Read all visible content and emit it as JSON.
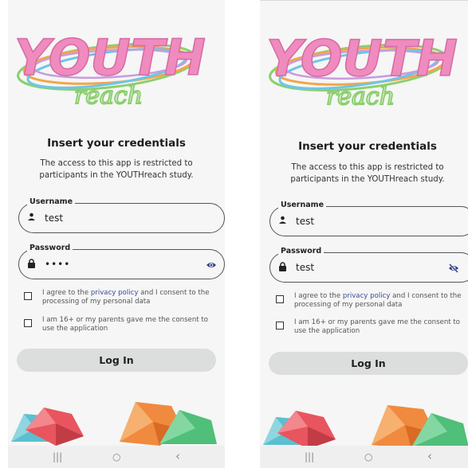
{
  "screens": [
    {
      "heading": "Insert your credentials",
      "description_line1": "The access to this app is restricted to",
      "description_line2": "participants in the YOUTHreach study.",
      "username": {
        "label": "Username",
        "value": "test"
      },
      "password": {
        "label": "Password",
        "value": "••••",
        "visibility_icon": "eye-icon"
      },
      "consent1": {
        "prefix": "I agree to the ",
        "link": "privacy policy",
        "suffix": " and I consent to the processing of my personal data",
        "checked": false
      },
      "consent2": {
        "text": "I am 16+ or my parents gave me the consent to use the application",
        "checked": false
      },
      "login_label": "Log In",
      "nav": {
        "recents": "|||",
        "home": "○",
        "back": "‹"
      }
    },
    {
      "heading": "Insert your credentials",
      "description_line1": "The access to this app is restricted to",
      "description_line2": "participants in the YOUTHreach study.",
      "username": {
        "label": "Username",
        "value": "test"
      },
      "password": {
        "label": "Password",
        "value": "test",
        "visibility_icon": "eye-off-icon"
      },
      "consent1": {
        "prefix": "I agree to the ",
        "link": "privacy policy",
        "suffix": " and I consent to the processing of my personal data",
        "checked": false
      },
      "consent2": {
        "text": "I am 16+ or my parents gave me the consent to use the application",
        "checked": false
      },
      "login_label": "Log In",
      "nav": {
        "recents": "|||",
        "home": "○",
        "back": "‹"
      }
    }
  ],
  "logo": {
    "title": "YOUTH",
    "subtitle": "reach"
  },
  "colors": {
    "logo_pink": "#ef8bbf",
    "logo_blue": "#6ec6e6",
    "logo_green": "#8ccf6f",
    "logo_orange": "#f3a54a",
    "field_border": "#555555",
    "button_bg": "#dcdedd",
    "link": "#3f4a9a"
  }
}
